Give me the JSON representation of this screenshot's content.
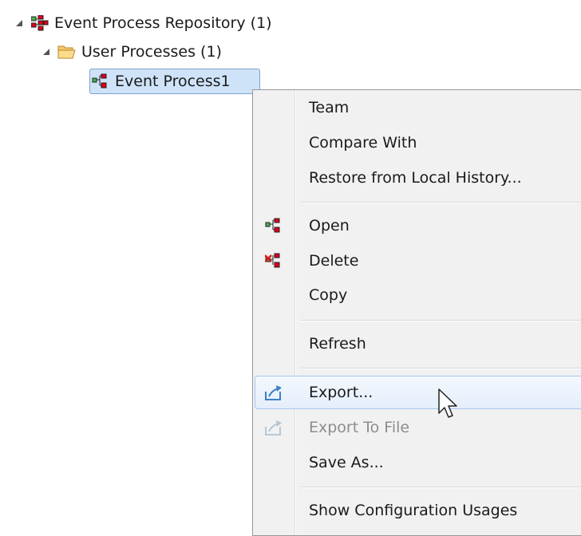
{
  "tree": {
    "root": {
      "label": "Event Process Repository (1)",
      "icon": "repository-icon"
    },
    "folder": {
      "label": "User Processes (1)",
      "icon": "folder-open-icon"
    },
    "item": {
      "label": "Event Process1",
      "icon": "event-process-icon"
    }
  },
  "menu": {
    "team": "Team",
    "compare_with": "Compare With",
    "restore": "Restore from Local History...",
    "open": "Open",
    "delete": "Delete",
    "copy": "Copy",
    "refresh": "Refresh",
    "export": "Export...",
    "export_to_file": "Export To File",
    "save_as": "Save As...",
    "show_config_usages": "Show Configuration Usages"
  },
  "colors": {
    "selection_bg": "#cfe3f8",
    "menu_bg": "#f1f1f1",
    "hover_border": "#a8c6ee",
    "icon_red": "#e0001b",
    "icon_green": "#4caf50"
  }
}
